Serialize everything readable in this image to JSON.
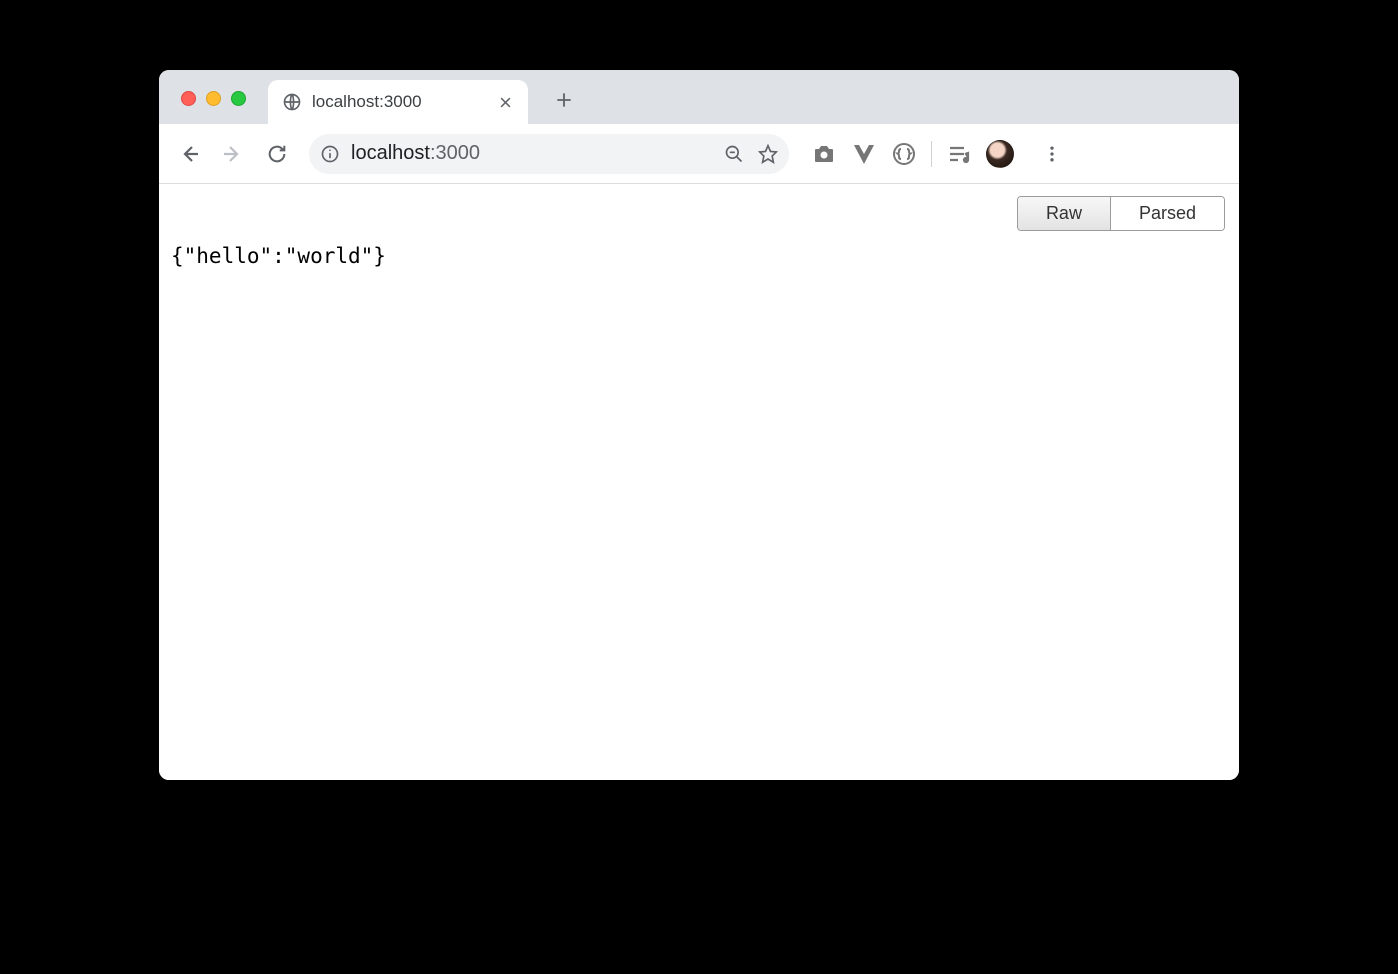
{
  "tab": {
    "title": "localhost:3000"
  },
  "address": {
    "host": "localhost",
    "port": ":3000"
  },
  "view_toggle": {
    "raw": "Raw",
    "parsed": "Parsed"
  },
  "body_text": "{\"hello\":\"world\"}"
}
